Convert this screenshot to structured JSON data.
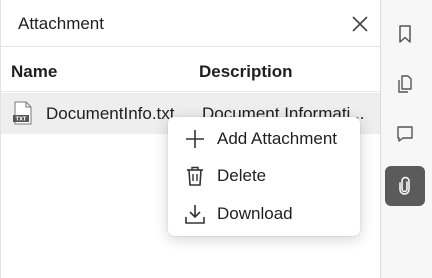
{
  "panel": {
    "title": "Attachment",
    "close_icon": "close-icon"
  },
  "table": {
    "columns": [
      "Name",
      "Description"
    ],
    "rows": [
      {
        "icon": "txt-file-icon",
        "file_type": "TXT",
        "name": "DocumentInfo.txt",
        "description": "Document Informati..."
      }
    ]
  },
  "context_menu": {
    "items": [
      {
        "icon": "plus-icon",
        "label": "Add Attachment"
      },
      {
        "icon": "trash-icon",
        "label": "Delete"
      },
      {
        "icon": "download-icon",
        "label": "Download"
      }
    ]
  },
  "sidebar": {
    "buttons": [
      {
        "icon": "bookmark-icon",
        "active": false
      },
      {
        "icon": "pages-icon",
        "active": false
      },
      {
        "icon": "comment-icon",
        "active": false
      },
      {
        "icon": "paperclip-icon",
        "active": true
      }
    ]
  },
  "colors": {
    "row_selected": "#eeeeee",
    "active_button": "#5b5b5b",
    "text": "#1f1f1f"
  }
}
